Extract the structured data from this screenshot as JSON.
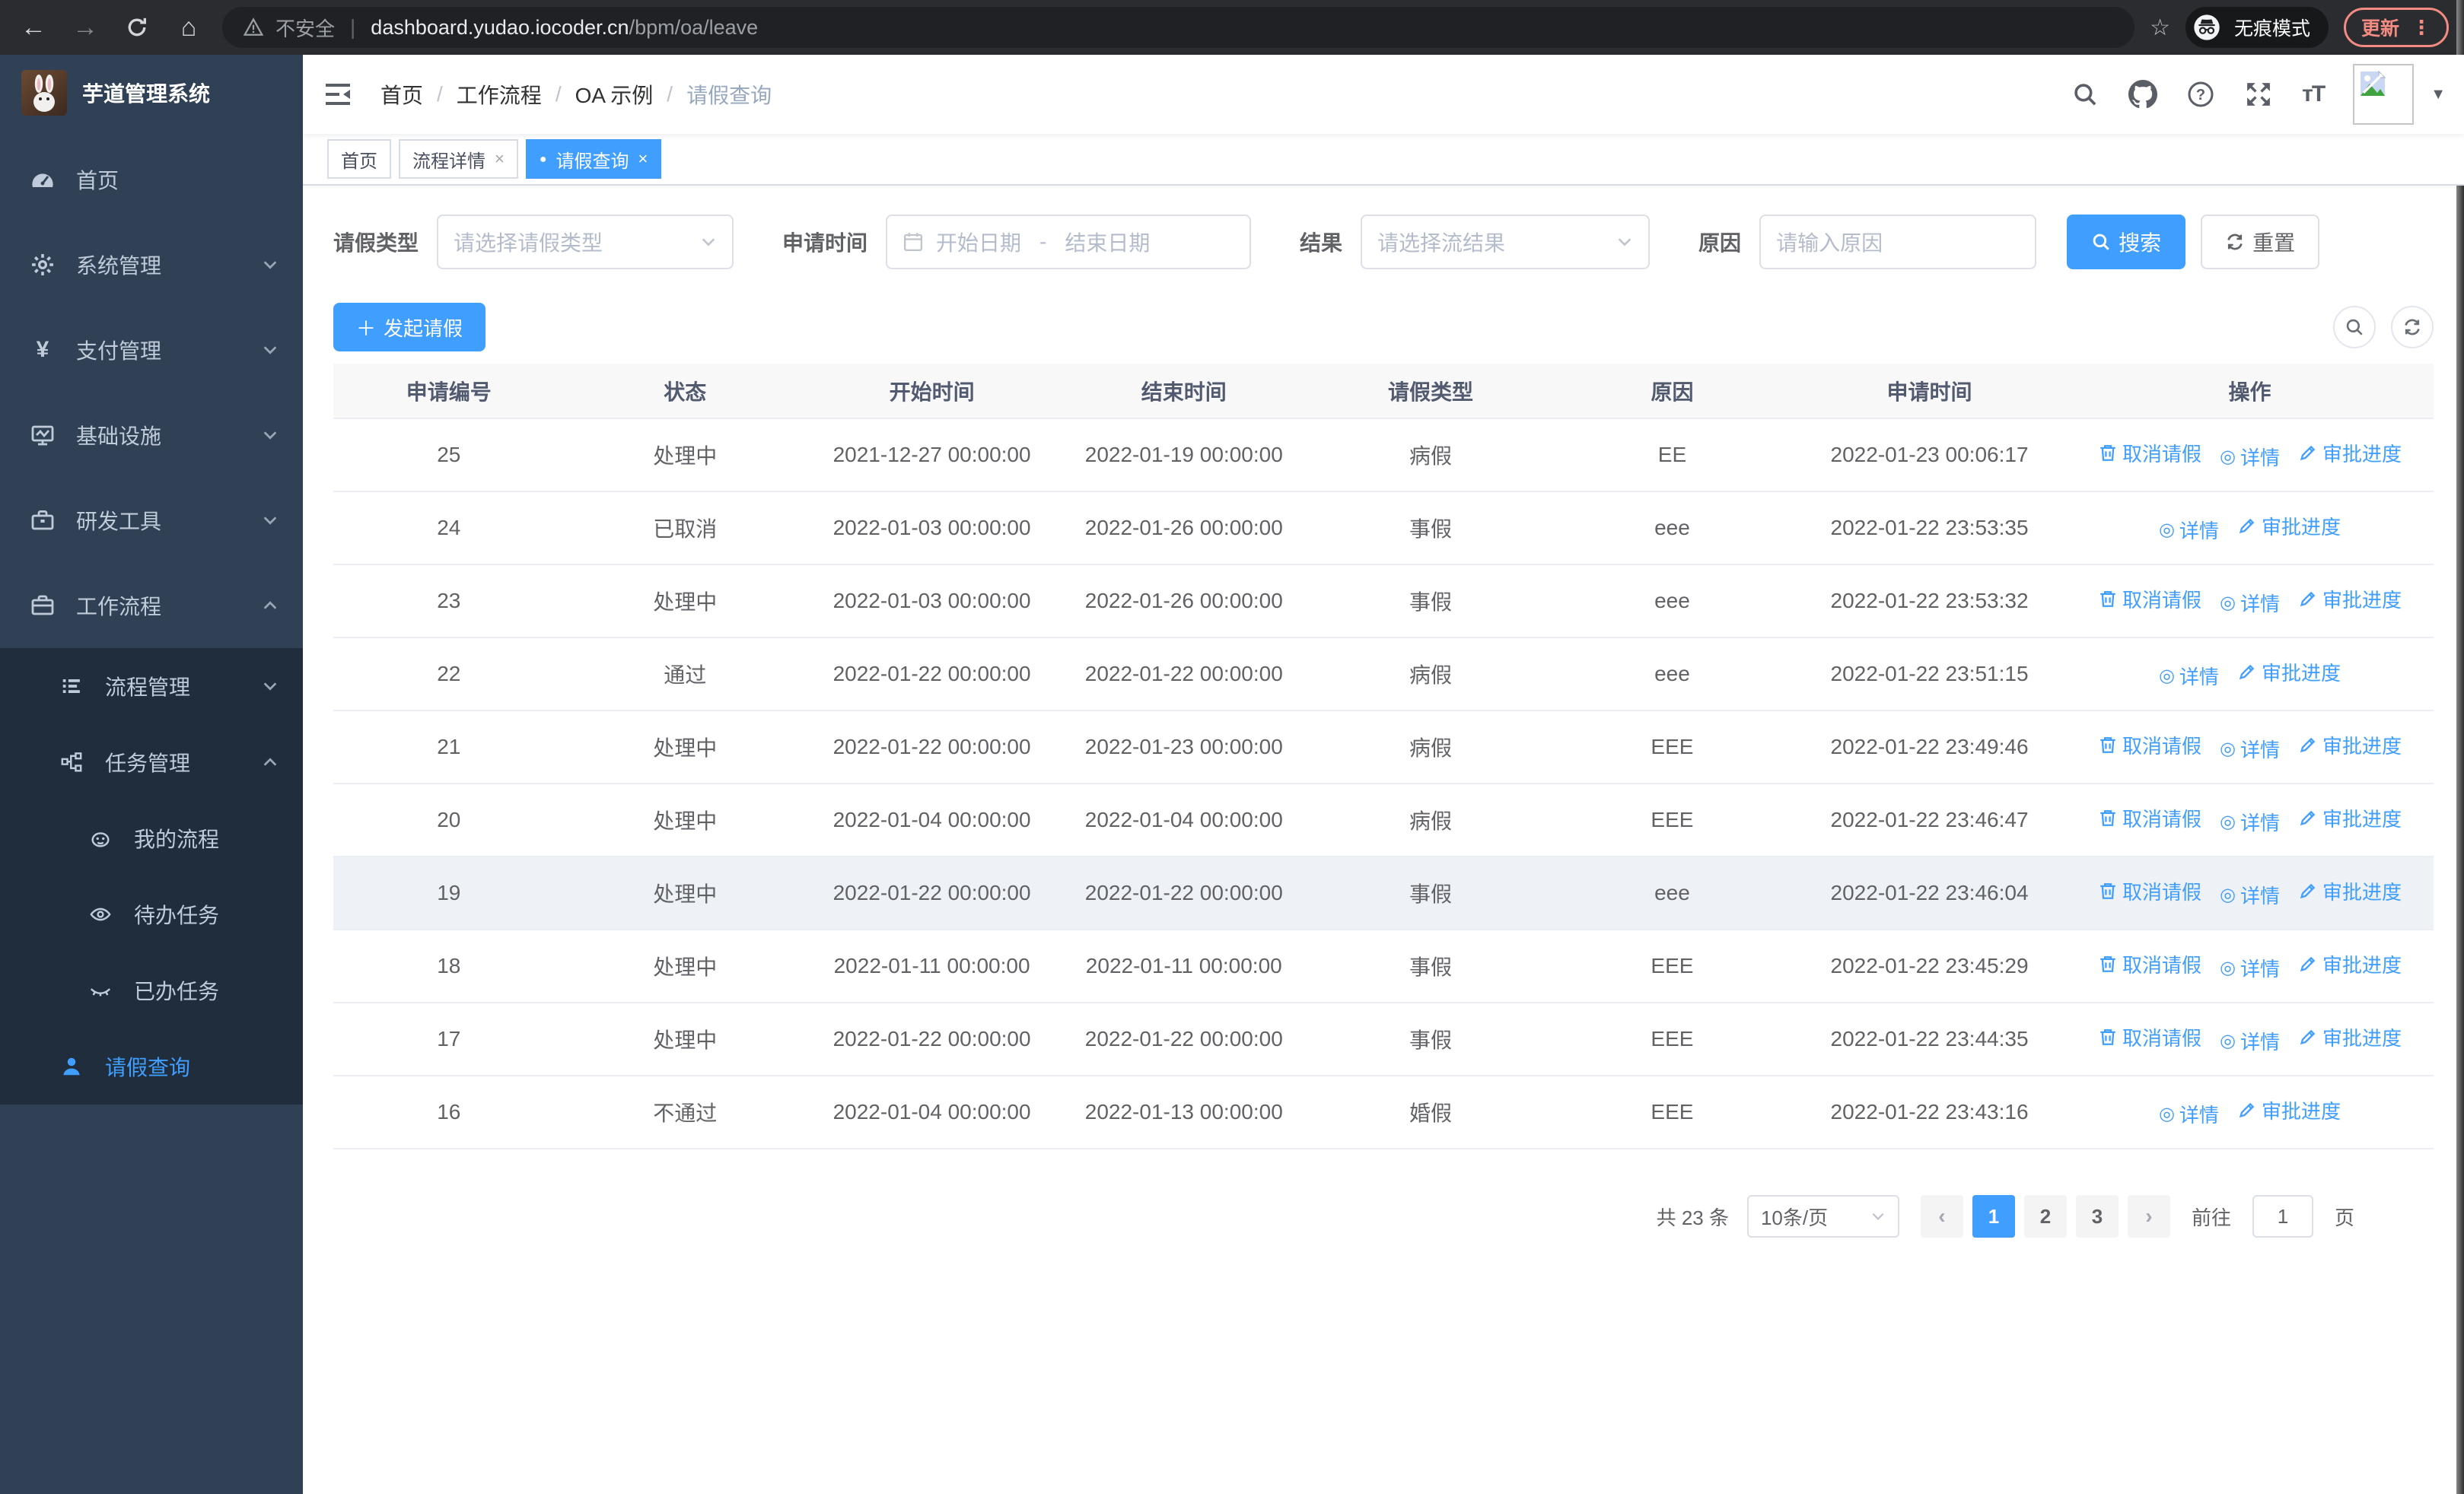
{
  "browser": {
    "security_label": "不安全",
    "url_host": "dashboard.yudao.iocoder.cn",
    "url_path": "/bpm/oa/leave",
    "incognito_label": "无痕模式",
    "update_label": "更新"
  },
  "sidebar": {
    "title": "芋道管理系统",
    "items": [
      {
        "label": "首页",
        "icon": "dashboard-icon"
      },
      {
        "label": "系统管理",
        "icon": "gear-icon"
      },
      {
        "label": "支付管理",
        "icon": "yen-icon"
      },
      {
        "label": "基础设施",
        "icon": "monitor-icon"
      },
      {
        "label": "研发工具",
        "icon": "toolbox-icon"
      },
      {
        "label": "工作流程",
        "icon": "briefcase-icon",
        "children": [
          {
            "label": "流程管理",
            "icon": "list-icon"
          },
          {
            "label": "任务管理",
            "icon": "tree-icon",
            "children": [
              {
                "label": "我的流程",
                "icon": "face-icon"
              },
              {
                "label": "待办任务",
                "icon": "eye-icon"
              },
              {
                "label": "已办任务",
                "icon": "eye-closed-icon"
              },
              {
                "label": "请假查询",
                "icon": "user-icon",
                "active": true
              }
            ]
          }
        ]
      }
    ]
  },
  "breadcrumb": [
    "首页",
    "工作流程",
    "OA 示例",
    "请假查询"
  ],
  "tabs": [
    {
      "label": "首页",
      "closable": false,
      "active": false
    },
    {
      "label": "流程详情",
      "closable": true,
      "active": false
    },
    {
      "label": "请假查询",
      "closable": true,
      "active": true
    }
  ],
  "filters": {
    "type_label": "请假类型",
    "type_placeholder": "请选择请假类型",
    "time_label": "申请时间",
    "start_placeholder": "开始日期",
    "range_separator": "-",
    "end_placeholder": "结束日期",
    "result_label": "结果",
    "result_placeholder": "请选择流结果",
    "reason_label": "原因",
    "reason_placeholder": "请输入原因",
    "search_label": "搜索",
    "reset_label": "重置"
  },
  "toolbar": {
    "create_label": "发起请假"
  },
  "table": {
    "columns": [
      "申请编号",
      "状态",
      "开始时间",
      "结束时间",
      "请假类型",
      "原因",
      "申请时间",
      "操作"
    ],
    "action_labels": {
      "cancel": "取消请假",
      "detail": "详情",
      "progress": "审批进度"
    },
    "rows": [
      {
        "id": "25",
        "status": "处理中",
        "start_time": "2021-12-27 00:00:00",
        "end_time": "2022-01-19 00:00:00",
        "leave_type": "病假",
        "reason": "EE",
        "apply_time": "2022-01-23 00:06:17",
        "actions": [
          "cancel",
          "detail",
          "progress"
        ],
        "highlighted": false
      },
      {
        "id": "24",
        "status": "已取消",
        "start_time": "2022-01-03 00:00:00",
        "end_time": "2022-01-26 00:00:00",
        "leave_type": "事假",
        "reason": "eee",
        "apply_time": "2022-01-22 23:53:35",
        "actions": [
          "detail",
          "progress"
        ],
        "highlighted": false
      },
      {
        "id": "23",
        "status": "处理中",
        "start_time": "2022-01-03 00:00:00",
        "end_time": "2022-01-26 00:00:00",
        "leave_type": "事假",
        "reason": "eee",
        "apply_time": "2022-01-22 23:53:32",
        "actions": [
          "cancel",
          "detail",
          "progress"
        ],
        "highlighted": false
      },
      {
        "id": "22",
        "status": "通过",
        "start_time": "2022-01-22 00:00:00",
        "end_time": "2022-01-22 00:00:00",
        "leave_type": "病假",
        "reason": "eee",
        "apply_time": "2022-01-22 23:51:15",
        "actions": [
          "detail",
          "progress"
        ],
        "highlighted": false
      },
      {
        "id": "21",
        "status": "处理中",
        "start_time": "2022-01-22 00:00:00",
        "end_time": "2022-01-23 00:00:00",
        "leave_type": "病假",
        "reason": "EEE",
        "apply_time": "2022-01-22 23:49:46",
        "actions": [
          "cancel",
          "detail",
          "progress"
        ],
        "highlighted": false
      },
      {
        "id": "20",
        "status": "处理中",
        "start_time": "2022-01-04 00:00:00",
        "end_time": "2022-01-04 00:00:00",
        "leave_type": "病假",
        "reason": "EEE",
        "apply_time": "2022-01-22 23:46:47",
        "actions": [
          "cancel",
          "detail",
          "progress"
        ],
        "highlighted": false
      },
      {
        "id": "19",
        "status": "处理中",
        "start_time": "2022-01-22 00:00:00",
        "end_time": "2022-01-22 00:00:00",
        "leave_type": "事假",
        "reason": "eee",
        "apply_time": "2022-01-22 23:46:04",
        "actions": [
          "cancel",
          "detail",
          "progress"
        ],
        "highlighted": true
      },
      {
        "id": "18",
        "status": "处理中",
        "start_time": "2022-01-11 00:00:00",
        "end_time": "2022-01-11 00:00:00",
        "leave_type": "事假",
        "reason": "EEE",
        "apply_time": "2022-01-22 23:45:29",
        "actions": [
          "cancel",
          "detail",
          "progress"
        ],
        "highlighted": false
      },
      {
        "id": "17",
        "status": "处理中",
        "start_time": "2022-01-22 00:00:00",
        "end_time": "2022-01-22 00:00:00",
        "leave_type": "事假",
        "reason": "EEE",
        "apply_time": "2022-01-22 23:44:35",
        "actions": [
          "cancel",
          "detail",
          "progress"
        ],
        "highlighted": false
      },
      {
        "id": "16",
        "status": "不通过",
        "start_time": "2022-01-04 00:00:00",
        "end_time": "2022-01-13 00:00:00",
        "leave_type": "婚假",
        "reason": "EEE",
        "apply_time": "2022-01-22 23:43:16",
        "actions": [
          "detail",
          "progress"
        ],
        "highlighted": false
      }
    ]
  },
  "pagination": {
    "total": "共 23 条",
    "page_size": "10条/页",
    "pages": [
      "1",
      "2",
      "3"
    ],
    "active_page": "1",
    "goto_label": "前往",
    "goto_value": "1",
    "goto_suffix": "页"
  }
}
